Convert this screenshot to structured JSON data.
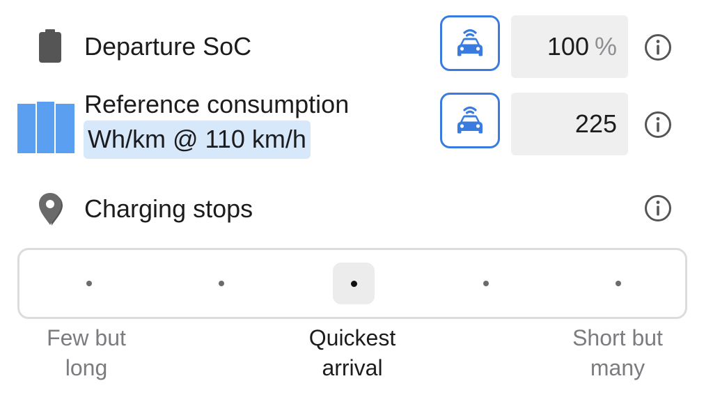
{
  "departure": {
    "icon": "battery-icon",
    "label": "Departure SoC",
    "car_button_icon": "connected-car-icon",
    "value": "100",
    "unit": "%",
    "info_icon": "info-icon"
  },
  "consumption": {
    "icon": "battery-bars-icon",
    "label": "Reference consumption",
    "unit_label": "Wh/km @ 110 km/h",
    "car_button_icon": "connected-car-icon",
    "value": "225",
    "info_icon": "info-icon"
  },
  "charging": {
    "icon": "map-pin-icon",
    "label": "Charging stops",
    "info_icon": "info-icon",
    "slider": {
      "positions": 5,
      "selected_index": 2,
      "labels": [
        {
          "line1": "Few but",
          "line2": "long"
        },
        {
          "line1": "Quickest",
          "line2": "arrival"
        },
        {
          "line1": "Short but",
          "line2": "many"
        }
      ]
    }
  },
  "colors": {
    "accent": "#3a7be0",
    "battery_blue": "#5b9ff0",
    "highlight": "#d7e8fb",
    "icon_gray": "#555555"
  }
}
